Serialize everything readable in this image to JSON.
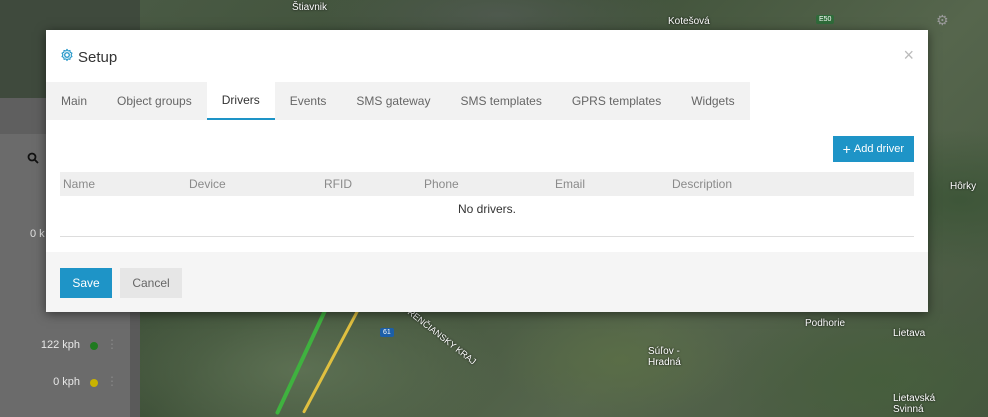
{
  "map": {
    "labels": [
      "Štiavnik",
      "Kotešová",
      "E50",
      "Hôrky",
      "Podhorie",
      "Lietava",
      "Súľov - Hradná",
      "Lietavská Svinná",
      "TRENČIANSKY KRAJ",
      "61"
    ]
  },
  "sidebar": {
    "zero_label": "0 k",
    "rows": [
      {
        "speed": "122 kph",
        "dot_color": "#1f7a1f"
      },
      {
        "speed": "0 kph",
        "dot_color": "#c9b300"
      }
    ]
  },
  "modal": {
    "title": "Setup",
    "tabs": [
      {
        "label": "Main",
        "active": false
      },
      {
        "label": "Object groups",
        "active": false
      },
      {
        "label": "Drivers",
        "active": true
      },
      {
        "label": "Events",
        "active": false
      },
      {
        "label": "SMS gateway",
        "active": false
      },
      {
        "label": "SMS templates",
        "active": false
      },
      {
        "label": "GPRS templates",
        "active": false
      },
      {
        "label": "Widgets",
        "active": false
      }
    ],
    "add_button_label": "Add driver",
    "table": {
      "columns": [
        "Name",
        "Device",
        "RFID",
        "Phone",
        "Email",
        "Description"
      ],
      "empty_message": "No drivers."
    },
    "footer": {
      "save_label": "Save",
      "cancel_label": "Cancel"
    }
  },
  "colors": {
    "accent": "#1e94c7"
  }
}
